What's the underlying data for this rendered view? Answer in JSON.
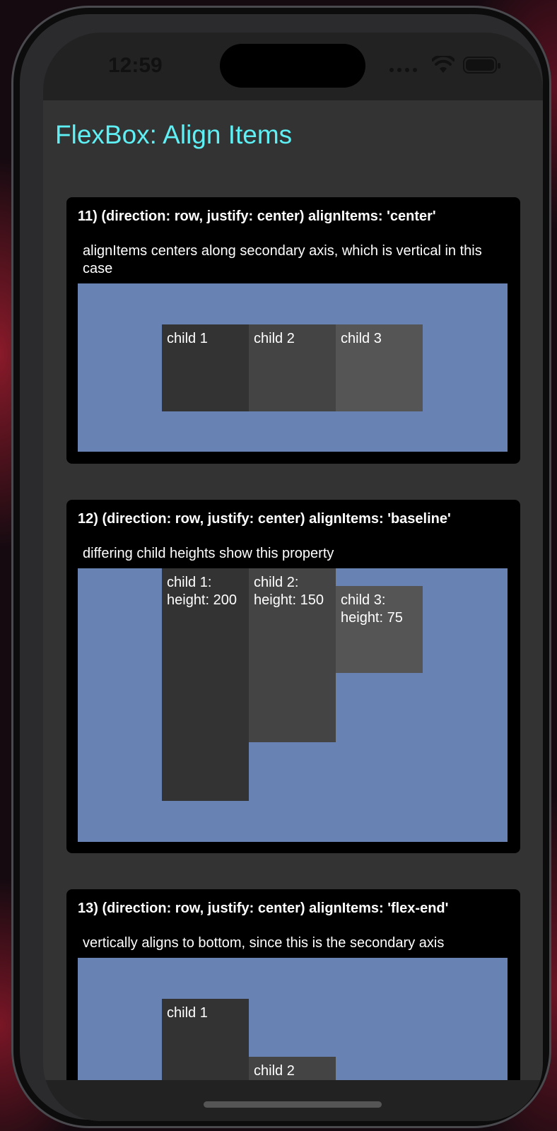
{
  "status": {
    "time": "12:59"
  },
  "page": {
    "title": "FlexBox: Align Items"
  },
  "cards": [
    {
      "heading": "11) (direction: row, justify: center) alignItems: 'center'",
      "description": "alignItems centers along secondary axis, which is vertical in this case",
      "children": [
        "child 1",
        "child 2",
        "child 3"
      ]
    },
    {
      "heading": "12) (direction: row, justify: center) alignItems: 'baseline'",
      "description": "differing child heights show this property",
      "children": [
        "child 1: height: 200",
        "child 2: height: 150",
        "child 3: height: 75"
      ]
    },
    {
      "heading": "13) (direction: row, justify: center) alignItems: 'flex-end'",
      "description": "vertically aligns to bottom, since this is the secondary axis",
      "children": [
        "child 1",
        "child 2"
      ]
    }
  ],
  "colors": {
    "title": "#5ef0f4",
    "demo_background": "#6882b4",
    "child_1": "#333333",
    "child_2": "#444444",
    "child_3": "#555555"
  }
}
